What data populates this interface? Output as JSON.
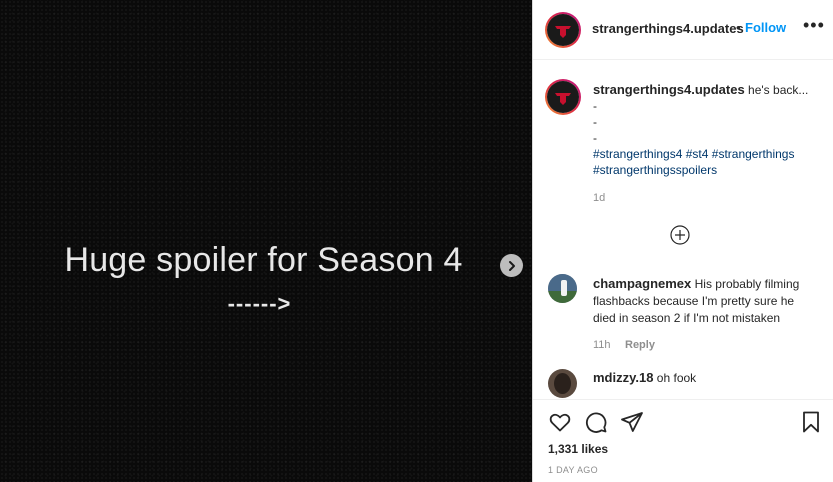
{
  "media": {
    "title": "Huge spoiler for Season 4",
    "arrow": "------>"
  },
  "post": {
    "username": "strangerthings4.updates",
    "follow_label": "Follow",
    "dot": "•",
    "more": "•••"
  },
  "caption": {
    "username": "strangerthings4.updates",
    "text": "he's back...",
    "dash_lines": [
      "-",
      "-",
      "-"
    ],
    "hashtags": [
      "#strangerthings4",
      "#st4",
      "#strangerthings",
      "#strangerthingsspoilers"
    ],
    "time": "1d"
  },
  "comments": [
    {
      "username": "champagnemex",
      "text": "His probably filming flashbacks because I'm pretty sure he died in season 2 if I'm not mistaken",
      "time": "11h",
      "reply_label": "Reply"
    },
    {
      "username": "mdizzy.18",
      "text": "oh fook"
    }
  ],
  "actions": {
    "likes": "1,331 likes",
    "posted": "1 DAY AGO"
  },
  "colors": {
    "accent": "#0095f6",
    "hashtag": "#00376b",
    "secondary_text": "#8e8e8e"
  },
  "icons": [
    "chevron-right-icon",
    "more-icon",
    "add-circle-icon",
    "heart-icon",
    "comment-icon",
    "share-icon",
    "bookmark-icon"
  ]
}
